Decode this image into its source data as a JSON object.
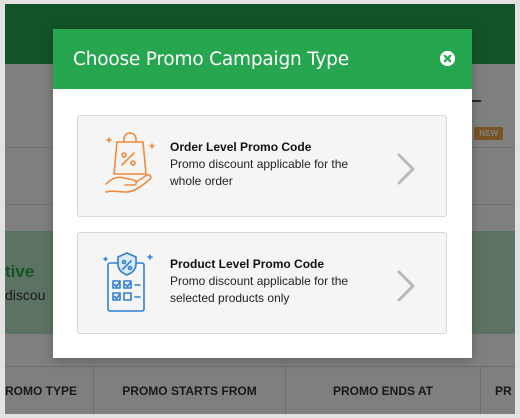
{
  "background": {
    "badge_new": "NEW",
    "banner": {
      "title": "tive",
      "subtitle": "discou"
    },
    "table_headers": [
      "ROMO TYPE",
      "PROMO STARTS FROM",
      "PROMO ENDS AT",
      "PR"
    ]
  },
  "modal": {
    "title": "Choose Promo Campaign Type",
    "close_icon": "close-icon",
    "options": [
      {
        "title": "Order Level Promo Code",
        "description": "Promo discount applicable for the whole order",
        "icon": "shopping-bag-hand-icon",
        "icon_color": "#f08a3c"
      },
      {
        "title": "Product Level Promo Code",
        "description": "Promo discount applicable for the selected products only",
        "icon": "product-checklist-icon",
        "icon_color": "#2f7fd6"
      }
    ]
  },
  "colors": {
    "primary_green": "#27a650",
    "banner_green": "#b9e7c8",
    "badge_orange": "#f1a84a",
    "chevron_gray": "#b8b8b8"
  }
}
